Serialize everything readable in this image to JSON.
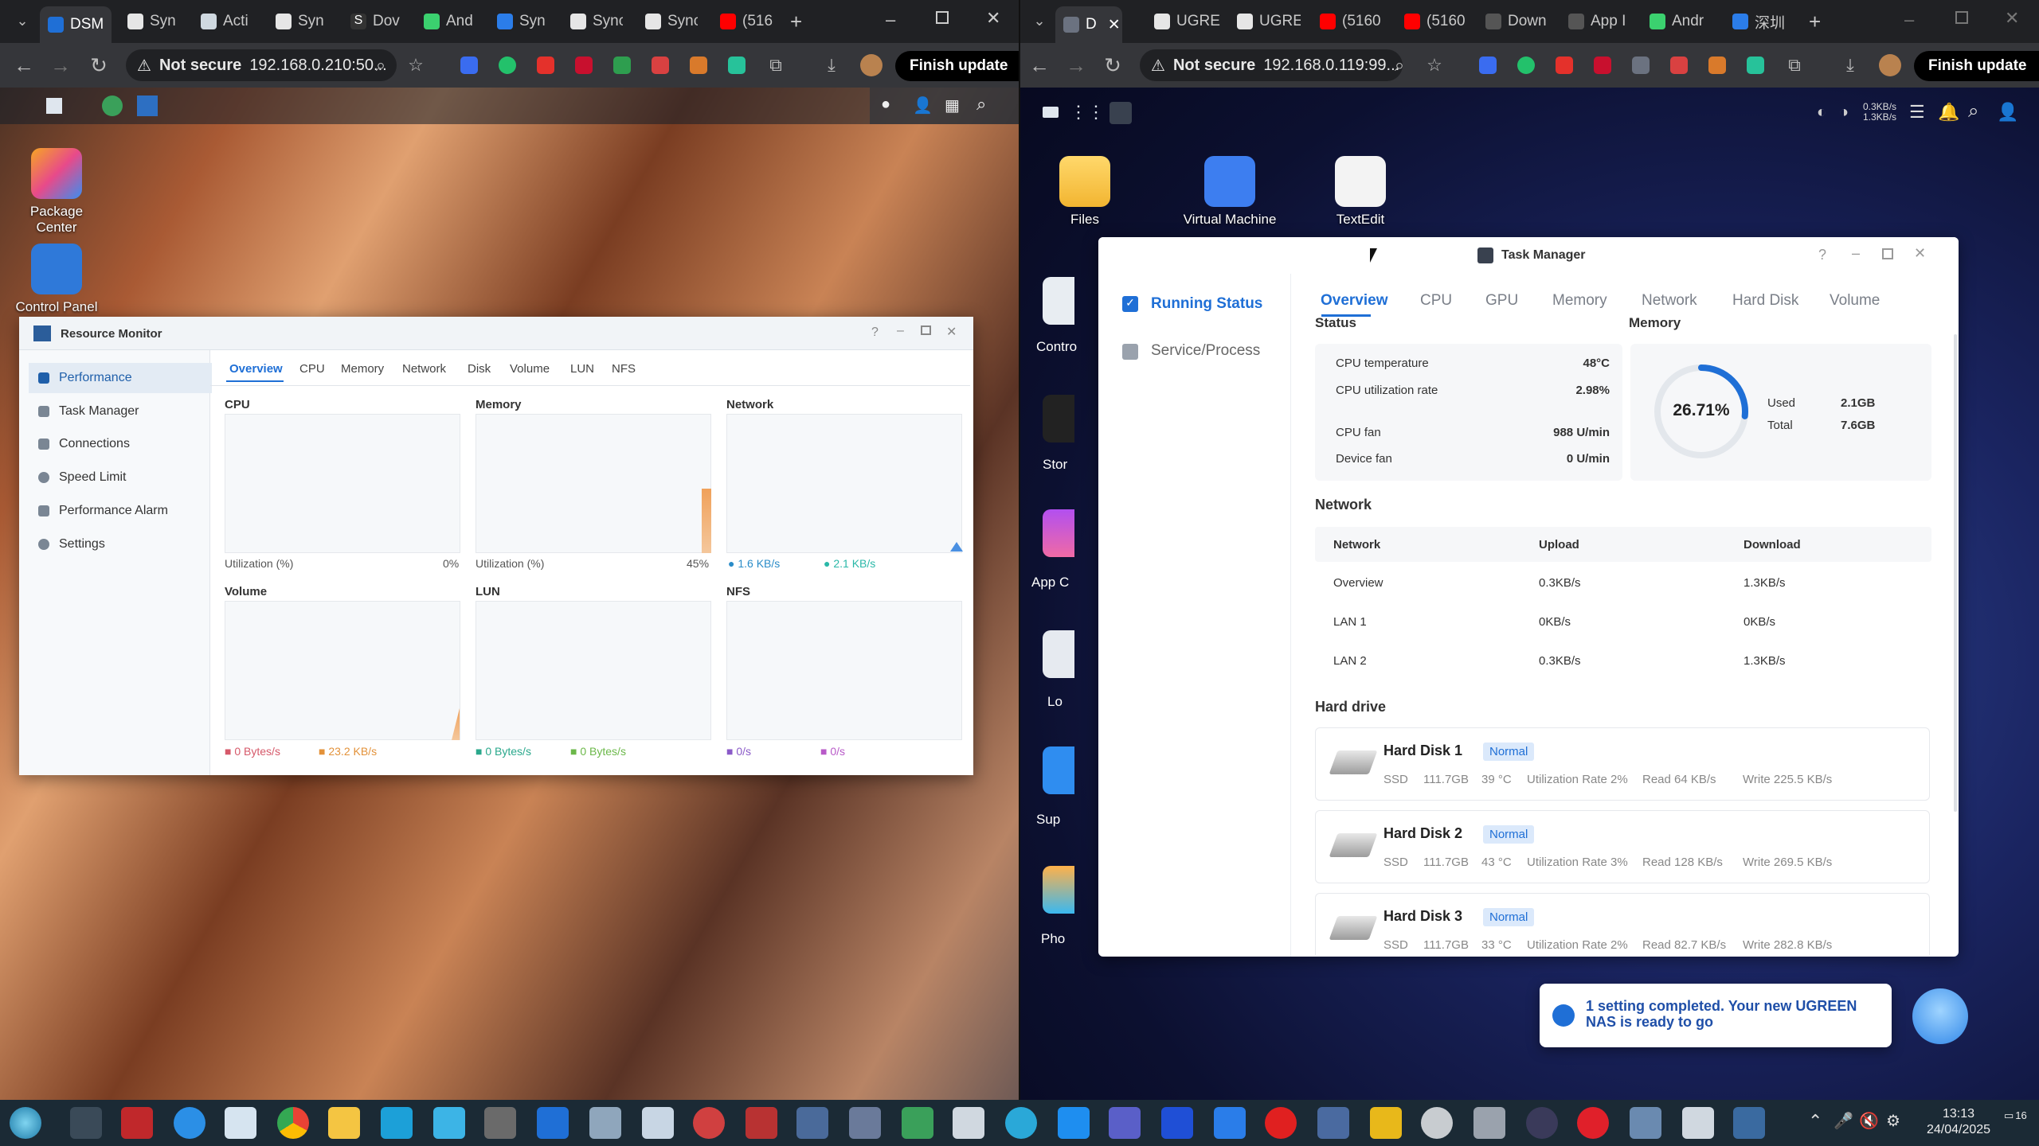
{
  "left_browser": {
    "tabs": [
      "DSM",
      "Syn",
      "Acti",
      "Syn",
      "Dov",
      "And",
      "Syn",
      "Sync",
      "(516",
      "+"
    ],
    "address": "192.168.0.210:50...",
    "security": "Not secure",
    "finish_update": "Finish update"
  },
  "right_browser": {
    "tabs": [
      "D",
      "UGRE",
      "UGRE",
      "(5160",
      "(5160",
      "Down",
      "App I",
      "Andr",
      "深圳"
    ],
    "address": "192.168.0.119:99...",
    "security": "Not secure",
    "finish_update": "Finish update"
  },
  "dsm_desktop": {
    "icons": [
      {
        "label": "Package Center"
      },
      {
        "label": "Control Panel"
      }
    ]
  },
  "resource_monitor": {
    "title": "Resource Monitor",
    "sidebar": [
      "Performance",
      "Task Manager",
      "Connections",
      "Speed Limit",
      "Performance Alarm",
      "Settings"
    ],
    "tabs": [
      "Overview",
      "CPU",
      "Memory",
      "Network",
      "Disk",
      "Volume",
      "LUN",
      "NFS"
    ],
    "panels": {
      "cpu": {
        "title": "CPU",
        "label": "Utilization (%)",
        "value": "0%"
      },
      "memory": {
        "title": "Memory",
        "label": "Utilization (%)",
        "value": "45%"
      },
      "network": {
        "title": "Network",
        "up": "1.6 KB/s",
        "down": "2.1 KB/s"
      },
      "volume": {
        "title": "Volume",
        "read": "0 Bytes/s",
        "write": "23.2 KB/s"
      },
      "lun": {
        "title": "LUN",
        "read": "0 Bytes/s",
        "write": "0 Bytes/s"
      },
      "nfs": {
        "title": "NFS",
        "read": "0/s",
        "write": "0/s"
      }
    }
  },
  "ugreen_desktop": {
    "icons": [
      "Files",
      "Virtual Machine",
      "TextEdit"
    ],
    "partial_labels": [
      "Contro",
      "Stor",
      "App C",
      "Lo",
      "Sup",
      "Pho"
    ],
    "top_speed": [
      "0.3KB/s",
      "1.3KB/s"
    ]
  },
  "task_manager": {
    "title": "Task Manager",
    "sidebar": [
      "Running Status",
      "Service/Process"
    ],
    "tabs": [
      "Overview",
      "CPU",
      "GPU",
      "Memory",
      "Network",
      "Hard Disk",
      "Volume"
    ],
    "status": {
      "heading": "Status",
      "rows": [
        {
          "k": "CPU temperature",
          "v": "48°C"
        },
        {
          "k": "CPU utilization rate",
          "v": "2.98%"
        },
        {
          "k": "CPU fan",
          "v": "988 U/min"
        },
        {
          "k": "Device fan",
          "v": "0 U/min"
        }
      ]
    },
    "memory": {
      "heading": "Memory",
      "percent": "26.71%",
      "percent_value": 26.71,
      "used_label": "Used",
      "used": "2.1GB",
      "total_label": "Total",
      "total": "7.6GB"
    },
    "network": {
      "heading": "Network",
      "columns": [
        "Network",
        "Upload",
        "Download"
      ],
      "rows": [
        [
          "Overview",
          "0.3KB/s",
          "1.3KB/s"
        ],
        [
          "LAN 1",
          "0KB/s",
          "0KB/s"
        ],
        [
          "LAN 2",
          "0.3KB/s",
          "1.3KB/s"
        ]
      ]
    },
    "hard_drive": {
      "heading": "Hard drive",
      "disks": [
        {
          "name": "Hard Disk 1",
          "status": "Normal",
          "type": "SSD",
          "size": "111.7GB",
          "temp": "39 °C",
          "util": "Utilization Rate 2%",
          "read": "Read 64 KB/s",
          "write": "Write 225.5 KB/s"
        },
        {
          "name": "Hard Disk 2",
          "status": "Normal",
          "type": "SSD",
          "size": "111.7GB",
          "temp": "43 °C",
          "util": "Utilization Rate 3%",
          "read": "Read 128 KB/s",
          "write": "Write 269.5 KB/s"
        },
        {
          "name": "Hard Disk 3",
          "status": "Normal",
          "type": "SSD",
          "size": "111.7GB",
          "temp": "33 °C",
          "util": "Utilization Rate 2%",
          "read": "Read 82.7 KB/s",
          "write": "Write 282.8 KB/s"
        }
      ]
    }
  },
  "notification": {
    "text": "1 setting completed. Your new UGREEN NAS is ready to go"
  },
  "taskbar": {
    "time": "13:13",
    "date": "24/04/2025",
    "badge": "16"
  }
}
